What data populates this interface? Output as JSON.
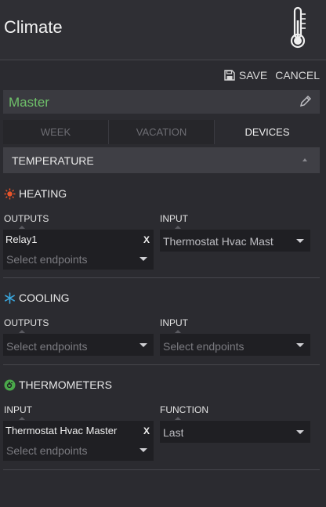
{
  "app": {
    "title": "Climate"
  },
  "actions": {
    "save_label": "SAVE",
    "cancel_label": "CANCEL"
  },
  "device": {
    "name": "Master",
    "name_color": "#6fc06a"
  },
  "tabs": [
    {
      "label": "WEEK",
      "active": false
    },
    {
      "label": "VACATION",
      "active": false
    },
    {
      "label": "DEVICES",
      "active": true
    }
  ],
  "section": {
    "label": "TEMPERATURE"
  },
  "heating": {
    "title": "HEATING",
    "icon": "sun-icon",
    "icon_color": "#e8542a",
    "outputs_label": "OUTPUTS",
    "outputs_selected": "Relay1",
    "outputs_placeholder": "Select endpoints",
    "input_label": "INPUT",
    "input_value": "Thermostat Hvac Mast"
  },
  "cooling": {
    "title": "COOLING",
    "icon": "snowflake-icon",
    "icon_color": "#3aa6dd",
    "outputs_label": "OUTPUTS",
    "outputs_placeholder": "Select endpoints",
    "input_label": "INPUT",
    "input_placeholder": "Select endpoints"
  },
  "thermometers": {
    "title": "THERMOMETERS",
    "icon": "thermometer-badge-icon",
    "icon_color": "#4aa84a",
    "input_label": "INPUT",
    "input_selected": "Thermostat Hvac Master",
    "input_placeholder": "Select endpoints",
    "function_label": "FUNCTION",
    "function_value": "Last"
  },
  "remove_glyph": "X"
}
